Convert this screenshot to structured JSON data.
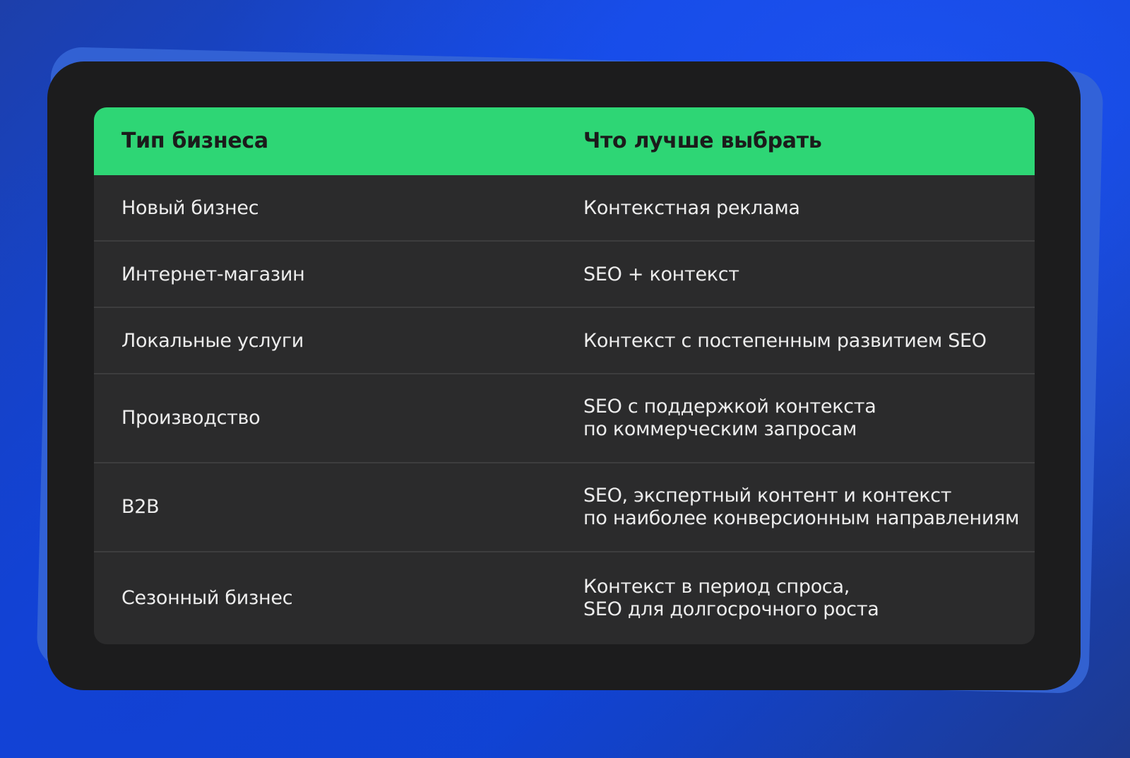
{
  "table": {
    "headers": [
      "Тип бизнеса",
      "Что лучше выбрать"
    ],
    "rows": [
      {
        "type": "Новый бизнес",
        "choice": [
          "Контекстная реклама"
        ]
      },
      {
        "type": "Интернет-магазин",
        "choice": [
          "SEO + контекст"
        ]
      },
      {
        "type": "Локальные услуги",
        "choice": [
          "Контекст с постепенным развитием SEO"
        ]
      },
      {
        "type": "Производство",
        "choice": [
          "SEO с поддержкой контекста",
          "по коммерческим запросам"
        ]
      },
      {
        "type": "B2B",
        "choice": [
          "SEO, экспертный контент и контекст",
          "по наиболее конверсионным направлениям"
        ]
      },
      {
        "type": "Сезонный бизнес",
        "choice": [
          "Контекст в период спроса,",
          "SEO для долгосрочного роста"
        ]
      }
    ]
  },
  "colors": {
    "header_bg": "#2ed675",
    "row_bg": "#2b2b2c",
    "panel_bg": "#1c1c1d",
    "page_bg": "#1047e0"
  }
}
